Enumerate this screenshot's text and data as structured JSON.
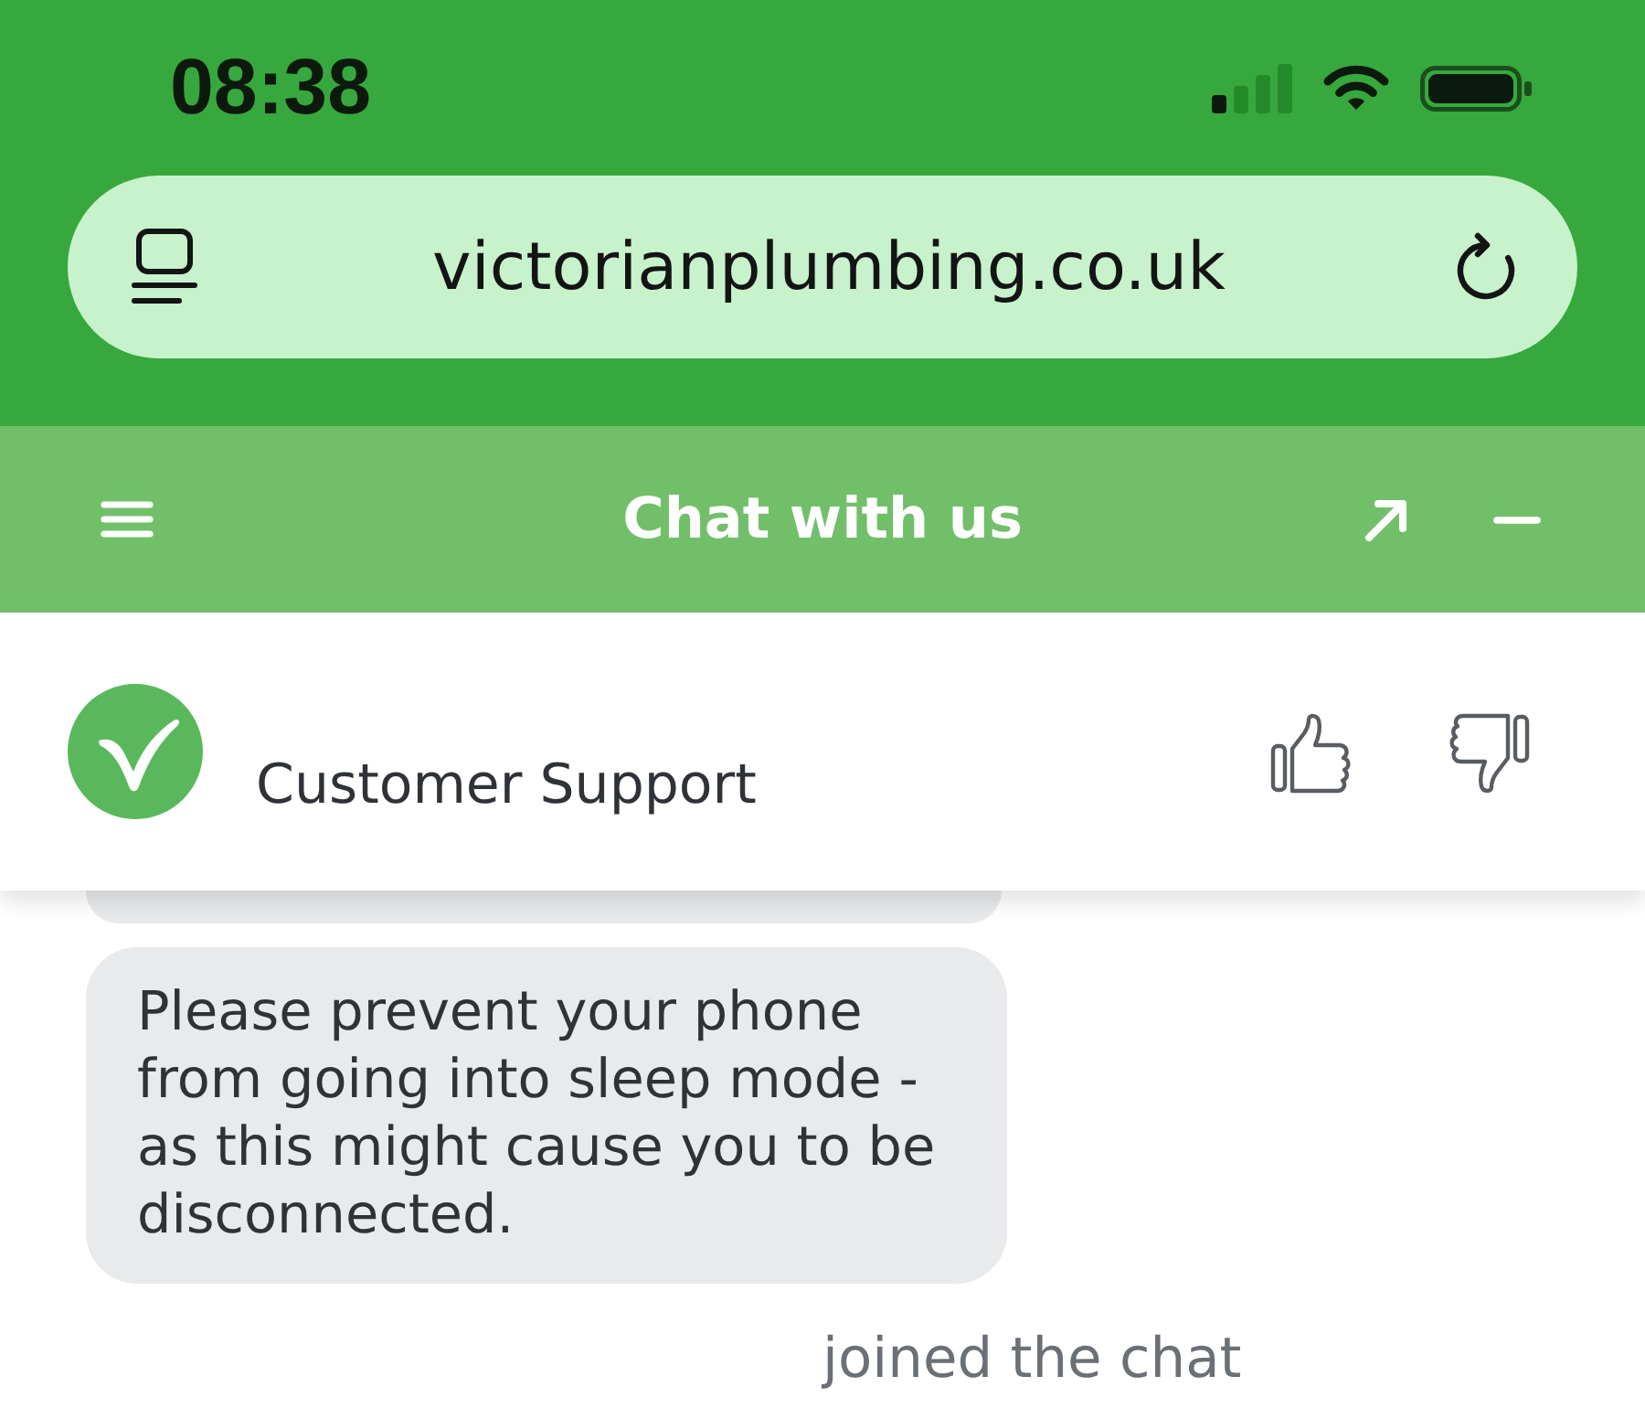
{
  "status_bar": {
    "time": "08:38"
  },
  "address_bar": {
    "url": "victorianplumbing.co.uk"
  },
  "chat_header": {
    "title": "Chat with us"
  },
  "agent": {
    "name": "Customer Support"
  },
  "messages": [
    {
      "kind": "partial"
    },
    {
      "kind": "bubble",
      "text": "Please prevent your phone from going into sleep mode - as this might cause you to be disconnected."
    },
    {
      "kind": "event",
      "text": "joined the chat"
    }
  ]
}
